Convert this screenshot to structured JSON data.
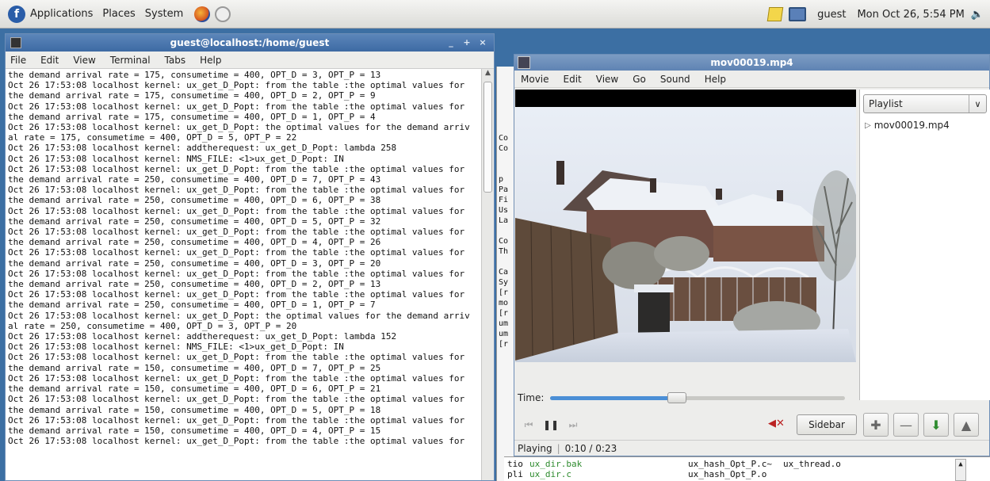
{
  "top_panel": {
    "menus": [
      "Applications",
      "Places",
      "System"
    ],
    "user": "guest",
    "clock": "Mon Oct 26,  5:54 PM"
  },
  "terminal": {
    "title": "guest@localhost:/home/guest",
    "menu": [
      "File",
      "Edit",
      "View",
      "Terminal",
      "Tabs",
      "Help"
    ],
    "lines": [
      "the demand arrival rate = 175, consumetime = 400, OPT_D = 3, OPT_P = 13",
      "Oct 26 17:53:08 localhost kernel: ux_get_D_Popt: from the table :the optimal values for",
      "the demand arrival rate = 175, consumetime = 400, OPT_D = 2, OPT_P = 9",
      "Oct 26 17:53:08 localhost kernel: ux_get_D_Popt: from the table :the optimal values for",
      "the demand arrival rate = 175, consumetime = 400, OPT_D = 1, OPT_P = 4",
      "Oct 26 17:53:08 localhost kernel: ux_get_D_Popt: the optimal values for the demand arriv",
      "al rate = 175, consumetime = 400, OPT_D = 5, OPT_P = 22",
      "Oct 26 17:53:08 localhost kernel: addtherequest: ux_get_D_Popt: lambda 258",
      "Oct 26 17:53:08 localhost kernel: NMS_FILE: <1>ux_get_D_Popt: IN",
      "Oct 26 17:53:08 localhost kernel: ux_get_D_Popt: from the table :the optimal values for",
      "the demand arrival rate = 250, consumetime = 400, OPT_D = 7, OPT_P = 43",
      "Oct 26 17:53:08 localhost kernel: ux_get_D_Popt: from the table :the optimal values for",
      "the demand arrival rate = 250, consumetime = 400, OPT_D = 6, OPT_P = 38",
      "Oct 26 17:53:08 localhost kernel: ux_get_D_Popt: from the table :the optimal values for",
      "the demand arrival rate = 250, consumetime = 400, OPT_D = 5, OPT_P = 32",
      "Oct 26 17:53:08 localhost kernel: ux_get_D_Popt: from the table :the optimal values for",
      "the demand arrival rate = 250, consumetime = 400, OPT_D = 4, OPT_P = 26",
      "Oct 26 17:53:08 localhost kernel: ux_get_D_Popt: from the table :the optimal values for",
      "the demand arrival rate = 250, consumetime = 400, OPT_D = 3, OPT_P = 20",
      "Oct 26 17:53:08 localhost kernel: ux_get_D_Popt: from the table :the optimal values for",
      "the demand arrival rate = 250, consumetime = 400, OPT_D = 2, OPT_P = 13",
      "Oct 26 17:53:08 localhost kernel: ux_get_D_Popt: from the table :the optimal values for",
      "the demand arrival rate = 250, consumetime = 400, OPT_D = 1, OPT_P = 7",
      "Oct 26 17:53:08 localhost kernel: ux_get_D_Popt: the optimal values for the demand arriv",
      "al rate = 250, consumetime = 400, OPT_D = 3, OPT_P = 20",
      "Oct 26 17:53:08 localhost kernel: addtherequest: ux_get_D_Popt: lambda 152",
      "Oct 26 17:53:08 localhost kernel: NMS_FILE: <1>ux_get_D_Popt: IN",
      "Oct 26 17:53:08 localhost kernel: ux_get_D_Popt: from the table :the optimal values for",
      "the demand arrival rate = 150, consumetime = 400, OPT_D = 7, OPT_P = 25",
      "Oct 26 17:53:08 localhost kernel: ux_get_D_Popt: from the table :the optimal values for",
      "the demand arrival rate = 150, consumetime = 400, OPT_D = 6, OPT_P = 21",
      "Oct 26 17:53:08 localhost kernel: ux_get_D_Popt: from the table :the optimal values for",
      "the demand arrival rate = 150, consumetime = 400, OPT_D = 5, OPT_P = 18",
      "Oct 26 17:53:08 localhost kernel: ux_get_D_Popt: from the table :the optimal values for",
      "the demand arrival rate = 150, consumetime = 400, OPT_D = 4, OPT_P = 15",
      "Oct 26 17:53:08 localhost kernel: ux_get_D_Popt: from the table :the optimal values for"
    ]
  },
  "background_window": {
    "lines": [
      "Co",
      "Co",
      "",
      "",
      "p",
      "Pa",
      "Fi",
      "Us",
      "La",
      "",
      "Co",
      "Th",
      "",
      "Ca",
      "Sy",
      "[r",
      "mo",
      "[r",
      "um",
      "um",
      "[r"
    ]
  },
  "player": {
    "title": "mov00019.mp4",
    "menu": [
      "Movie",
      "Edit",
      "View",
      "Go",
      "Sound",
      "Help"
    ],
    "playlist_dropdown": "Playlist",
    "playlist_items": [
      "mov00019.mp4"
    ],
    "time_label": "Time:",
    "seek_fraction": 0.43,
    "sidebar_button": "Sidebar",
    "status_state": "Playing",
    "status_time": "0:10 / 0:23"
  },
  "files_window": {
    "left_cut": [
      "tio",
      "pli"
    ],
    "col1": [
      "ux_dir.bak",
      "ux_dir.c"
    ],
    "col2": [
      "ux_hash_Opt_P.c~",
      "ux_hash_Opt_P.o"
    ],
    "col3": [
      "ux_thread.o",
      ""
    ]
  }
}
